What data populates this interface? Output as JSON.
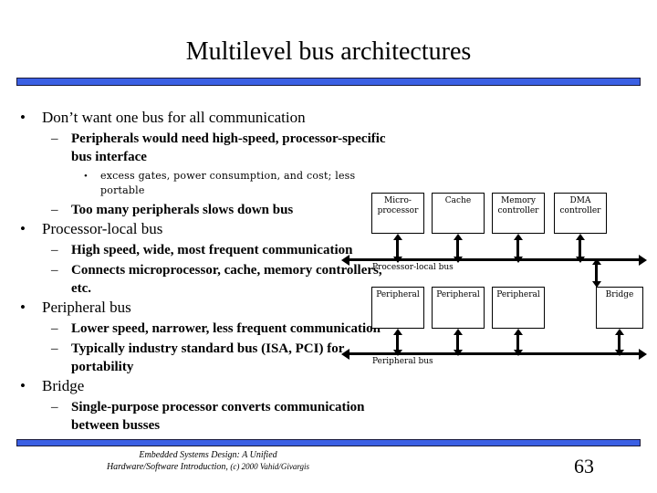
{
  "slide": {
    "title": "Multilevel bus architectures",
    "page_number": "63",
    "accent_color": "#3b60e4",
    "text_color": "#000000"
  },
  "bullets": [
    {
      "level": 1,
      "mark": "•",
      "text": "Don’t want one bus for all communication"
    },
    {
      "level": 2,
      "mark": "–",
      "text": "Peripherals would need high-speed, processor-specific bus interface"
    },
    {
      "level": 3,
      "mark": "•",
      "text": "excess gates, power consumption, and cost; less portable"
    },
    {
      "level": 2,
      "mark": "–",
      "text": "Too many peripherals slows down bus"
    },
    {
      "level": 1,
      "mark": "•",
      "text": "Processor-local bus"
    },
    {
      "level": 2,
      "mark": "–",
      "text": "High speed, wide, most frequent communication"
    },
    {
      "level": 2,
      "mark": "–",
      "text": "Connects microprocessor, cache, memory controllers, etc."
    },
    {
      "level": 1,
      "mark": "•",
      "text": "Peripheral bus"
    },
    {
      "level": 2,
      "mark": "–",
      "text": "Lower speed, narrower, less frequent communication"
    },
    {
      "level": 2,
      "mark": "–",
      "text": "Typically industry standard bus (ISA, PCI) for portability"
    },
    {
      "level": 1,
      "mark": "•",
      "text": "Bridge"
    },
    {
      "level": 2,
      "mark": "–",
      "text": "Single-purpose processor converts communication between busses"
    }
  ],
  "diagram": {
    "top_row": [
      {
        "line1": "Micro-",
        "line2": "processor"
      },
      {
        "line1": "Cache",
        "line2": ""
      },
      {
        "line1": "Memory",
        "line2": "controller"
      },
      {
        "line1": "DMA",
        "line2": "controller"
      }
    ],
    "bottom_row": [
      {
        "line1": "Peripheral",
        "line2": ""
      },
      {
        "line1": "Peripheral",
        "line2": ""
      },
      {
        "line1": "Peripheral",
        "line2": ""
      },
      {
        "line1": "Bridge",
        "line2": ""
      }
    ],
    "bus_labels": {
      "processor_local": "Processor-local bus",
      "peripheral": "Peripheral bus"
    }
  },
  "footer": {
    "line1": "Embedded Systems Design: A Unified",
    "line2": "Hardware/Software Introduction,",
    "line2_suffix": "(c) 2000 Vahid/Givargis"
  }
}
